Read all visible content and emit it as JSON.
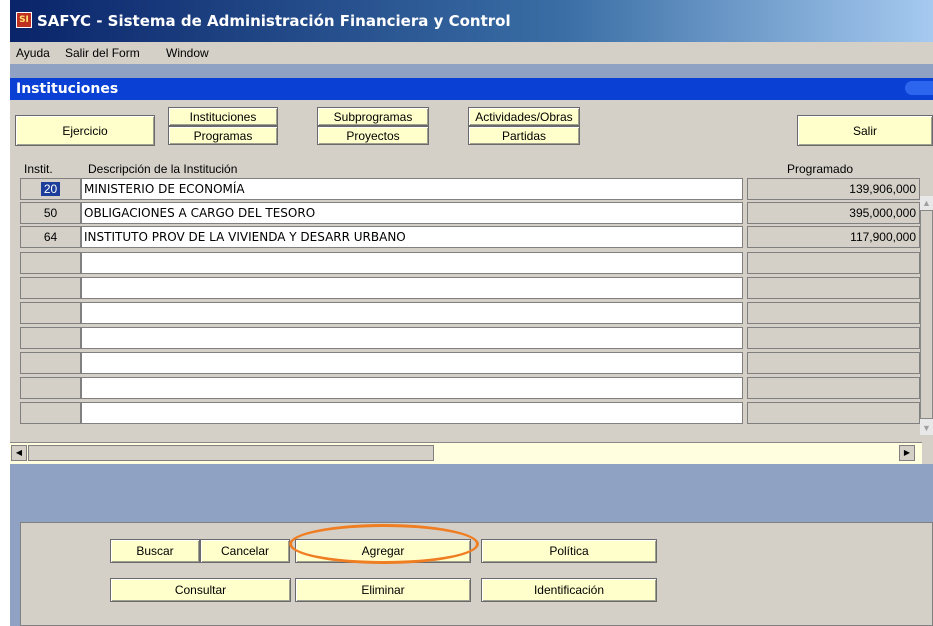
{
  "window": {
    "title": "SAFYC - Sistema de Administración Financiera y Control",
    "icon": "safyc-app-icon"
  },
  "menu": [
    "Ayuda",
    "Salir del Form",
    "Window"
  ],
  "form": {
    "title": "Instituciones"
  },
  "toolbar": {
    "ejercicio": "Ejercicio",
    "instituciones": "Instituciones",
    "programas": "Programas",
    "subprogramas": "Subprogramas",
    "proyectos": "Proyectos",
    "actividades": "Actividades/Obras",
    "partidas": "Partidas",
    "salir": "Salir"
  },
  "grid": {
    "headers": {
      "instit": "Instit.",
      "descripcion": "Descripción de la Institución",
      "programado": "Programado"
    },
    "rows": [
      {
        "instit": "20",
        "descripcion": "MINISTERIO DE ECONOMÍA",
        "programado": "139,906,000",
        "selected": true
      },
      {
        "instit": "50",
        "descripcion": "OBLIGACIONES A CARGO DEL TESORO",
        "programado": "395,000,000"
      },
      {
        "instit": "64",
        "descripcion": "INSTITUTO PROV DE LA VIVIENDA Y DESARR URBANO",
        "programado": "117,900,000"
      }
    ]
  },
  "actions": {
    "buscar": "Buscar",
    "cancelar": "Cancelar",
    "agregar": "Agregar",
    "politica": "Política",
    "consultar": "Consultar",
    "eliminar": "Eliminar",
    "identificacion": "Identificación"
  },
  "colors": {
    "title_bar": "#0a246a",
    "form_title": "#0a40d4",
    "button_bg": "#ffffcc",
    "highlight": "#ef7d22",
    "window_bg": "#8fa2c4"
  }
}
